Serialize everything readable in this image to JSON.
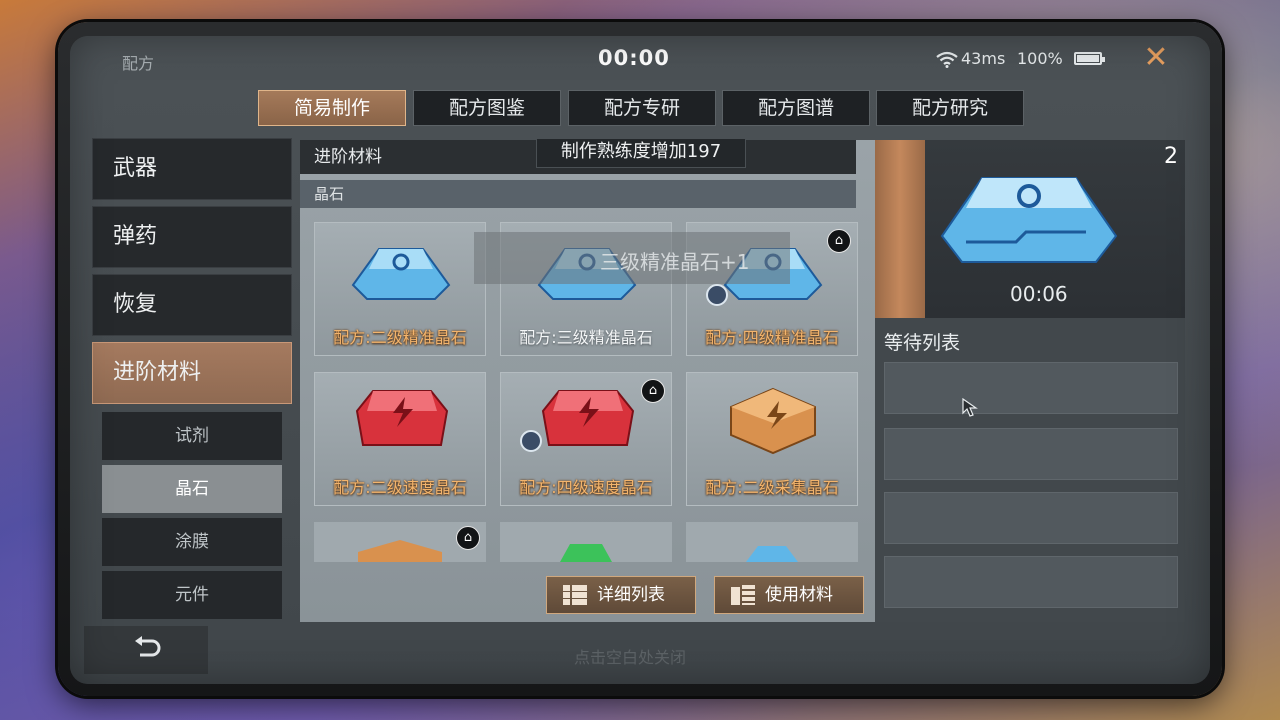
{
  "window": {
    "title": "配方",
    "clock": "00:00",
    "ping": "43ms",
    "battery": "100%"
  },
  "tabs": [
    {
      "label": "简易制作",
      "active": true
    },
    {
      "label": "配方图鉴",
      "active": false
    },
    {
      "label": "配方专研",
      "active": false
    },
    {
      "label": "配方图谱",
      "active": false
    },
    {
      "label": "配方研究",
      "active": false
    }
  ],
  "sidebar": {
    "categories": [
      {
        "label": "武器",
        "active": false
      },
      {
        "label": "弹药",
        "active": false
      },
      {
        "label": "恢复",
        "active": false
      },
      {
        "label": "进阶材料",
        "active": true
      }
    ],
    "subcategories": [
      {
        "label": "试剂",
        "active": false
      },
      {
        "label": "晶石",
        "active": true
      },
      {
        "label": "涂膜",
        "active": false
      },
      {
        "label": "元件",
        "active": false
      }
    ]
  },
  "content": {
    "header": "进阶材料",
    "toast": "制作熟练度增加197",
    "section": "晶石",
    "floating_text": "三级精准晶石+1",
    "recipes": [
      {
        "label": "配方:二级精准晶石",
        "color": "blue",
        "style": "gold"
      },
      {
        "label": "配方:三级精准晶石",
        "color": "blue",
        "style": "white"
      },
      {
        "label": "配方:四级精准晶石",
        "color": "blue",
        "style": "gold",
        "upgrade": true
      },
      {
        "label": "配方:二级速度晶石",
        "color": "red",
        "style": "gold"
      },
      {
        "label": "配方:四级速度晶石",
        "color": "red",
        "style": "gold",
        "upgrade": true
      },
      {
        "label": "配方:二级采集晶石",
        "color": "orange",
        "style": "gold"
      }
    ],
    "buttons": {
      "detail_list": "详细列表",
      "use_material": "使用材料"
    }
  },
  "production": {
    "count": "2",
    "timer": "00:06",
    "queue_title": "等待列表"
  },
  "footer": {
    "hint": "点击空白处关闭"
  },
  "colors": {
    "accent": "#c4885c",
    "gold_text": "#f3b46c",
    "close": "#e8a060"
  }
}
